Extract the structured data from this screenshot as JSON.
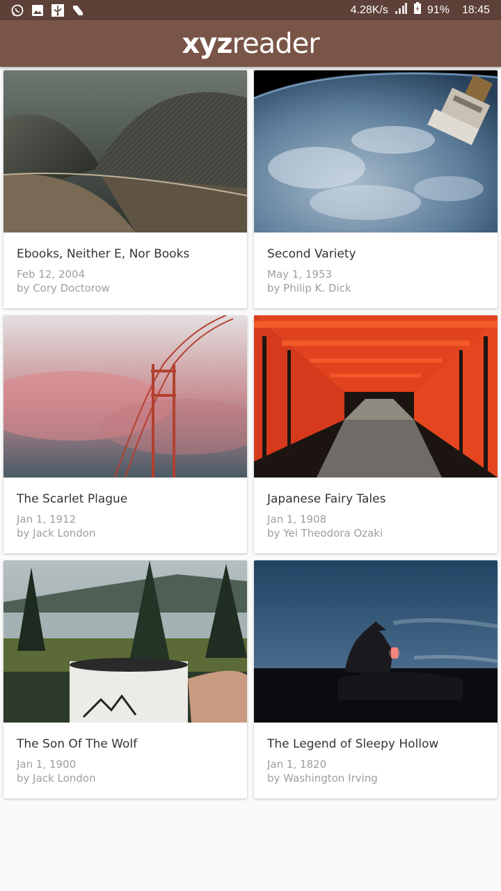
{
  "status_bar": {
    "left_icons": [
      "whatsapp-icon",
      "gallery-icon",
      "usb-icon",
      "n-icon"
    ],
    "net_speed": "4.28K/s",
    "battery": "91%",
    "time": "18:45"
  },
  "app_bar": {
    "logo_bold": "xyz",
    "logo_rest": "reader"
  },
  "articles": [
    {
      "title": "Ebooks, Neither E, Nor Books",
      "date": "Feb 12, 2004",
      "author": "by Cory Doctorow"
    },
    {
      "title": "Second Variety",
      "date": "May 1, 1953",
      "author": "by Philip K. Dick"
    },
    {
      "title": "The Scarlet Plague",
      "date": "Jan 1, 1912",
      "author": "by Jack London"
    },
    {
      "title": "Japanese Fairy Tales",
      "date": "Jan 1, 1908",
      "author": "by Yei Theodora Ozaki"
    },
    {
      "title": "The Son Of The Wolf",
      "date": "Jan 1, 1900",
      "author": "by Jack London"
    },
    {
      "title": "The Legend of Sleepy Hollow",
      "date": "Jan 1, 1820",
      "author": "by Washington Irving"
    }
  ],
  "colors": {
    "status_bar": "#5d4037",
    "app_bar": "#795548"
  }
}
